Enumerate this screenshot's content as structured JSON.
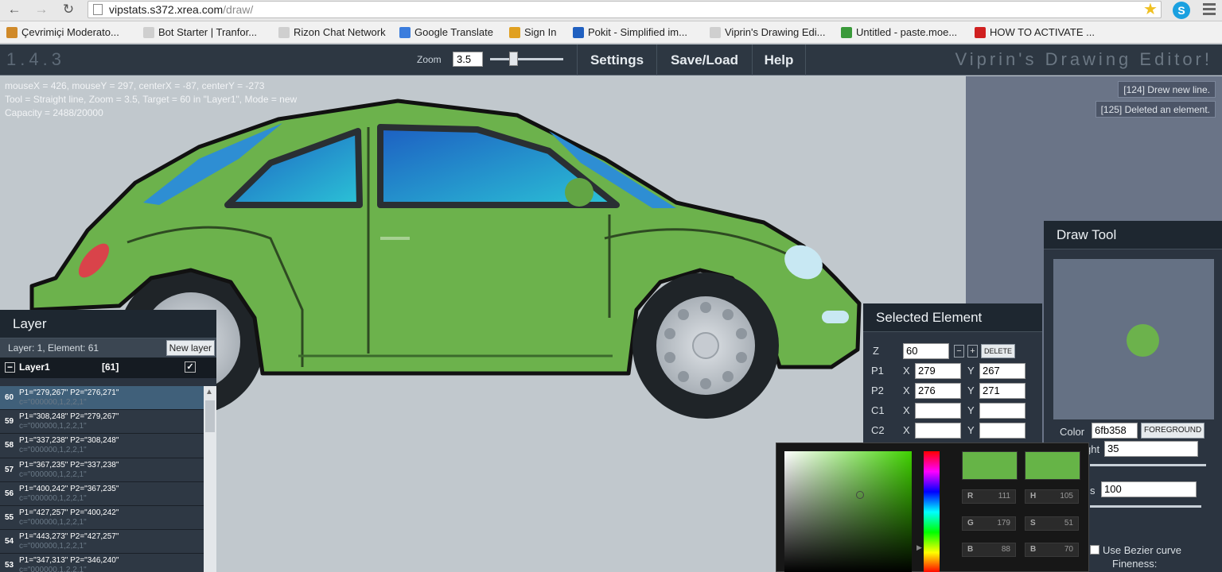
{
  "browser": {
    "url_host": "vipstats.s372.xrea.com",
    "url_path": "/draw/",
    "bookmarks": [
      {
        "label": "Çevrimiçi Moderato...",
        "color": "#d08a2a"
      },
      {
        "label": "Bot Starter | Tranfor...",
        "color": "#cfcfcf"
      },
      {
        "label": "Rizon Chat Network",
        "color": "#cfcfcf"
      },
      {
        "label": "Google Translate",
        "color": "#3b7ddd"
      },
      {
        "label": "Sign In",
        "color": "#e0a020"
      },
      {
        "label": "Pokit - Simplified im...",
        "color": "#2060c0"
      },
      {
        "label": "Viprin's Drawing Edi...",
        "color": "#cfcfcf"
      },
      {
        "label": "Untitled - paste.moe...",
        "color": "#3a9a3a"
      },
      {
        "label": "HOW TO ACTIVATE ...",
        "color": "#d02020"
      }
    ]
  },
  "app": {
    "version": "1.4.3",
    "zoom_label": "Zoom",
    "zoom_value": "3.5",
    "zoom_level": 0.3,
    "menu": {
      "settings": "Settings",
      "saveload": "Save/Load",
      "help": "Help"
    },
    "title": "Viprin's Drawing Editor!"
  },
  "status": {
    "line1": "mouseX = 426, mouseY = 297, centerX = -87, centerY = -273",
    "line2": "Tool = Straight line, Zoom = 3.5, Target = 60 in \"Layer1\", Mode = new",
    "line3": "Capacity = 2488/20000"
  },
  "log": [
    "[124] Drew new line.",
    "[125] Deleted an element."
  ],
  "layer_panel": {
    "title": "Layer",
    "info": "Layer: 1, Element: 61",
    "new_layer": "New layer",
    "layer_name": "Layer1",
    "layer_count": "[61]",
    "elements": [
      {
        "idx": "60",
        "line1": "P1=\"279,267\" P2=\"276,271\"",
        "line2": "c=\"000000,1,2,2,1\"",
        "selected": true
      },
      {
        "idx": "59",
        "line1": "P1=\"308,248\" P2=\"279,267\"",
        "line2": "c=\"000000,1,2,2,1\"",
        "selected": false
      },
      {
        "idx": "58",
        "line1": "P1=\"337,238\" P2=\"308,248\"",
        "line2": "c=\"000000,1,2,2,1\"",
        "selected": false
      },
      {
        "idx": "57",
        "line1": "P1=\"367,235\" P2=\"337,238\"",
        "line2": "c=\"000000,1,2,2,1\"",
        "selected": false
      },
      {
        "idx": "56",
        "line1": "P1=\"400,242\" P2=\"367,235\"",
        "line2": "c=\"000000,1,2,2,1\"",
        "selected": false
      },
      {
        "idx": "55",
        "line1": "P1=\"427,257\" P2=\"400,242\"",
        "line2": "c=\"000000,1,2,2,1\"",
        "selected": false
      },
      {
        "idx": "54",
        "line1": "P1=\"443,273\" P2=\"427,257\"",
        "line2": "c=\"000000,1,2,2,1\"",
        "selected": false
      },
      {
        "idx": "53",
        "line1": "P1=\"347,313\" P2=\"346,240\"",
        "line2": "c=\"000000,1,2,2,1\"",
        "selected": false
      }
    ]
  },
  "selected_element": {
    "title": "Selected Element",
    "z_label": "Z",
    "z": "60",
    "delete": "DELETE",
    "p1_label": "P1",
    "p1x": "279",
    "p1y": "267",
    "p2_label": "P2",
    "p2x": "276",
    "p2y": "271",
    "c1_label": "C1",
    "c2_label": "C2",
    "x_label": "X",
    "y_label": "Y"
  },
  "draw_tool": {
    "title": "Draw Tool",
    "color_label": "Color",
    "color_value": "6fb358",
    "foreground": "FOREGROUND",
    "weight_label": "ght",
    "weight": "35",
    "alpha_label": "s",
    "alpha": "100",
    "alpha_level": 1.0,
    "bezier": "Use Bezier curve",
    "fineness": "Fineness:"
  },
  "color_picker": {
    "r_label": "R",
    "r": "111",
    "g_label": "G",
    "g": "179",
    "b_label": "B",
    "b": "88",
    "h_label": "H",
    "h": "105",
    "s_label": "S",
    "s": "51",
    "v_label": "B",
    "v": "70"
  },
  "colors": {
    "car_body": "#6cb24c",
    "window": "#2b8ad2",
    "header": "#2d3742",
    "panel": "#2b3440"
  }
}
